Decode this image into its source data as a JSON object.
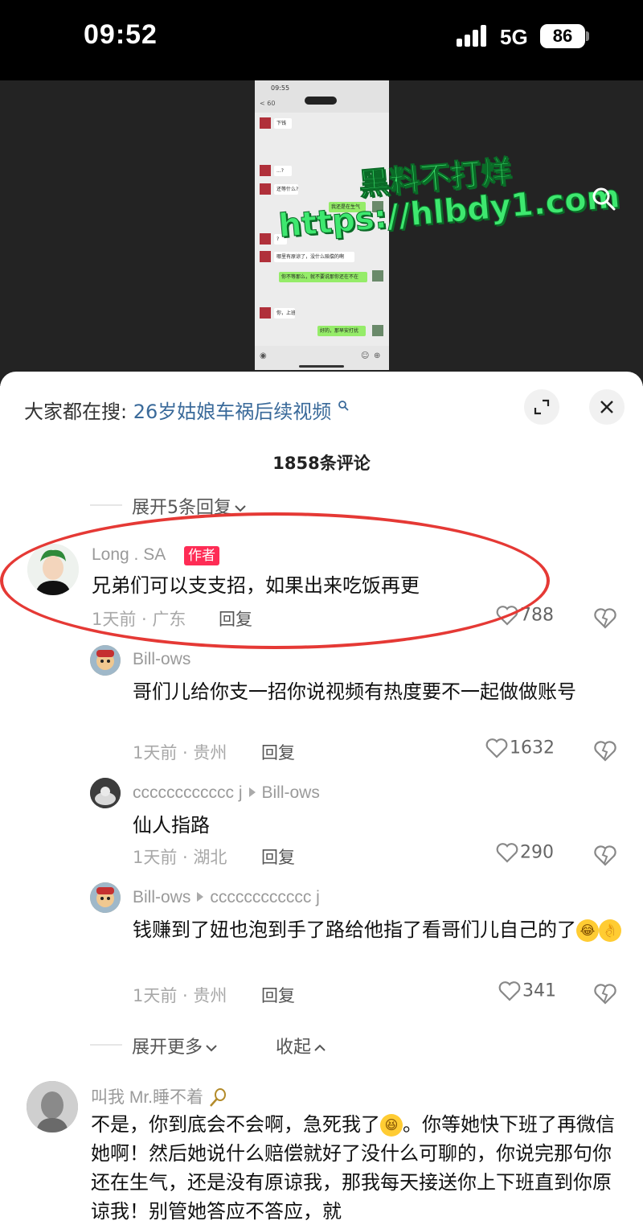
{
  "status_bar": {
    "time": "09:52",
    "network": "5G",
    "battery": "86"
  },
  "video": {
    "watermark_title": "黑料不打烊",
    "watermark_url": "https://hlbdy1.com",
    "screenshot": {
      "time": "09:55",
      "back": "< 60",
      "messages": [
        {
          "side": "left",
          "text": "下钱"
        },
        {
          "side": "left",
          "text": "...?"
        },
        {
          "side": "left",
          "text": "还等什么?"
        },
        {
          "side": "right",
          "text": "我还是在生气"
        },
        {
          "side": "left",
          "text": "?"
        },
        {
          "side": "left",
          "text": "哪里有原谅了，没什么赔偿的啊"
        },
        {
          "side": "right",
          "text": "你不等那么，就不要说那你还在不在"
        },
        {
          "side": "left",
          "text": "你，上班了"
        },
        {
          "side": "right",
          "text": "好的，那早安打扰"
        }
      ]
    }
  },
  "panel": {
    "search_prompt_label": "大家都在搜:",
    "search_prompt_term": "26岁姑娘车祸后续视频",
    "comment_count": "1858条评论",
    "expand_replies": "展开5条回复",
    "expand_more": "展开更多",
    "collapse": "收起",
    "comments": [
      {
        "user": "Long . SA",
        "badge": "作者",
        "text": "兄弟们可以支支招，如果出来吃饭再更",
        "time_loc": "1天前 · 广东",
        "reply": "回复",
        "likes": "788"
      },
      {
        "user": "Bill-ows",
        "text": "哥们儿给你支一招你说视频有热度要不一起做做账号",
        "time_loc": "1天前 · 贵州",
        "reply": "回复",
        "likes": "1632"
      },
      {
        "user": "cccccccccccc j",
        "reply_to": "Bill-ows",
        "text": "仙人指路",
        "time_loc": "1天前 · 湖北",
        "reply": "回复",
        "likes": "290"
      },
      {
        "user": "Bill-ows",
        "reply_to": "cccccccccccc j",
        "text": "钱赚到了妞也泡到手了路给他指了看哥们儿自己的了",
        "time_loc": "1天前 · 贵州",
        "reply": "回复",
        "likes": "341"
      },
      {
        "user": "叫我 Mr.睡不着",
        "text_a": "不是，你到底会不会啊，急死我了",
        "text_b": "。你等她快下班了再微信她啊！然后她说什么赔偿就好了没什么可聊的，你说完那句你还在生气，还是没有原谅我，那我每天接送你上下班直到你原谅我！别管她答应不答应，就"
      }
    ]
  },
  "colors": {
    "accent_red": "#fe2c55",
    "search_term": "#3a6a9a",
    "watermark": "#3ee86f"
  }
}
